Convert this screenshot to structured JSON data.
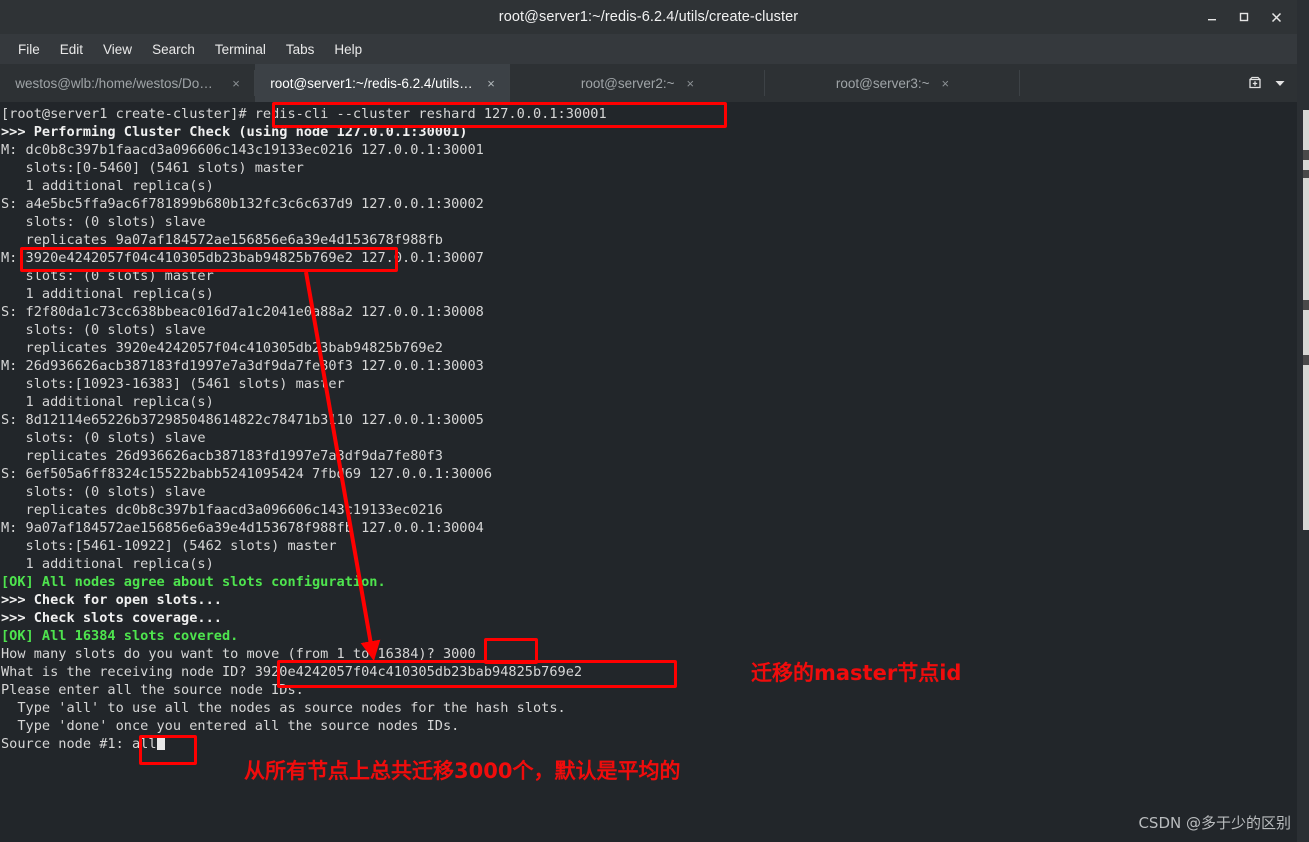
{
  "window": {
    "title": "root@server1:~/redis-6.2.4/utils/create-cluster",
    "minimize_label": "Minimize",
    "maximize_label": "Maximize",
    "close_label": "Close"
  },
  "menu": {
    "items": [
      {
        "label": "File"
      },
      {
        "label": "Edit"
      },
      {
        "label": "View"
      },
      {
        "label": "Search"
      },
      {
        "label": "Terminal"
      },
      {
        "label": "Tabs"
      },
      {
        "label": "Help"
      }
    ]
  },
  "tabs": {
    "items": [
      {
        "label": "westos@wlb:/home/westos/Dow…",
        "close": "×",
        "active": false
      },
      {
        "label": "root@server1:~/redis-6.2.4/utils/c…",
        "close": "×",
        "active": true
      },
      {
        "label": "root@server2:~",
        "close": "×",
        "active": false
      },
      {
        "label": "root@server3:~",
        "close": "×",
        "active": false
      }
    ],
    "new_tab_icon": "new-tab-icon",
    "tab_menu_icon": "chevron-down-icon"
  },
  "terminal": {
    "lines": [
      {
        "text": "[root@server1 create-cluster]# redis-cli --cluster reshard 127.0.0.1:30001",
        "style": "normal"
      },
      {
        "text": ">>> Performing Cluster Check (using node 127.0.0.1:30001)",
        "style": "bold"
      },
      {
        "text": "M: dc0b8c397b1faacd3a096606c143c19133ec0216 127.0.0.1:30001",
        "style": "normal"
      },
      {
        "text": "   slots:[0-5460] (5461 slots) master",
        "style": "normal"
      },
      {
        "text": "   1 additional replica(s)",
        "style": "normal"
      },
      {
        "text": "S: a4e5bc5ffa9ac6f781899b680b132fc3c6c637d9 127.0.0.1:30002",
        "style": "normal"
      },
      {
        "text": "   slots: (0 slots) slave",
        "style": "normal"
      },
      {
        "text": "   replicates 9a07af184572ae156856e6a39e4d153678f988fb",
        "style": "normal"
      },
      {
        "text": "M: 3920e4242057f04c410305db23bab94825b769e2 127.0.0.1:30007",
        "style": "normal"
      },
      {
        "text": "   slots: (0 slots) master",
        "style": "normal"
      },
      {
        "text": "   1 additional replica(s)",
        "style": "normal"
      },
      {
        "text": "S: f2f80da1c73cc638bbeac016d7a1c2041e0a88a2 127.0.0.1:30008",
        "style": "normal"
      },
      {
        "text": "   slots: (0 slots) slave",
        "style": "normal"
      },
      {
        "text": "   replicates 3920e4242057f04c410305db23bab94825b769e2",
        "style": "normal"
      },
      {
        "text": "M: 26d936626acb387183fd1997e7a3df9da7fe80f3 127.0.0.1:30003",
        "style": "normal"
      },
      {
        "text": "   slots:[10923-16383] (5461 slots) master",
        "style": "normal"
      },
      {
        "text": "   1 additional replica(s)",
        "style": "normal"
      },
      {
        "text": "S: 8d12114e65226b372985048614822c78471b3110 127.0.0.1:30005",
        "style": "normal"
      },
      {
        "text": "   slots: (0 slots) slave",
        "style": "normal"
      },
      {
        "text": "   replicates 26d936626acb387183fd1997e7a3df9da7fe80f3",
        "style": "normal"
      },
      {
        "text": "S: 6ef505a6ff8324c15522babb5241095424 7fbd69 127.0.0.1:30006",
        "style": "normal"
      },
      {
        "text": "   slots: (0 slots) slave",
        "style": "normal"
      },
      {
        "text": "   replicates dc0b8c397b1faacd3a096606c143c19133ec0216",
        "style": "normal"
      },
      {
        "text": "M: 9a07af184572ae156856e6a39e4d153678f988fb 127.0.0.1:30004",
        "style": "normal"
      },
      {
        "text": "   slots:[5461-10922] (5462 slots) master",
        "style": "normal"
      },
      {
        "text": "   1 additional replica(s)",
        "style": "normal"
      },
      {
        "text": "[OK] All nodes agree about slots configuration.",
        "style": "ok"
      },
      {
        "text": ">>> Check for open slots...",
        "style": "bold"
      },
      {
        "text": ">>> Check slots coverage...",
        "style": "bold"
      },
      {
        "text": "[OK] All 16384 slots covered.",
        "style": "ok"
      },
      {
        "text": "How many slots do you want to move (from 1 to 16384)? 3000",
        "style": "normal"
      },
      {
        "text": "What is the receiving node ID? 3920e4242057f04c410305db23bab94825b769e2",
        "style": "normal"
      },
      {
        "text": "Please enter all the source node IDs.",
        "style": "normal"
      },
      {
        "text": "  Type 'all' to use all the nodes as source nodes for the hash slots.",
        "style": "normal"
      },
      {
        "text": "  Type 'done' once you entered all the source nodes IDs.",
        "style": "normal"
      },
      {
        "text": "Source node #1: all",
        "style": "cursor"
      }
    ],
    "prompt": "[root@server1 create-cluster]#",
    "command": "redis-cli --cluster reshard 127.0.0.1:30001",
    "slots_to_move": "3000",
    "receiving_node_id": "3920e4242057f04c410305db23bab94825b769e2",
    "source_node_input": "all"
  },
  "annotations": {
    "colors": {
      "highlight": "#ff0000",
      "ok_green": "#4ee44e",
      "selection_blue": "#3a6ea5"
    },
    "notes": [
      {
        "id": "note-master-id",
        "text": "迁移的master节点id"
      },
      {
        "id": "note-migrate-total",
        "text": "从所有节点上总共迁移3000个，默认是平均的"
      }
    ],
    "boxes": [
      {
        "id": "box-command"
      },
      {
        "id": "box-node-id-30007"
      },
      {
        "id": "box-slots-3000"
      },
      {
        "id": "box-receiving-node-id"
      },
      {
        "id": "box-source-all"
      }
    ],
    "arrow": {
      "id": "annotation-arrow"
    }
  },
  "watermark": {
    "text": "CSDN @多于少的区别"
  }
}
